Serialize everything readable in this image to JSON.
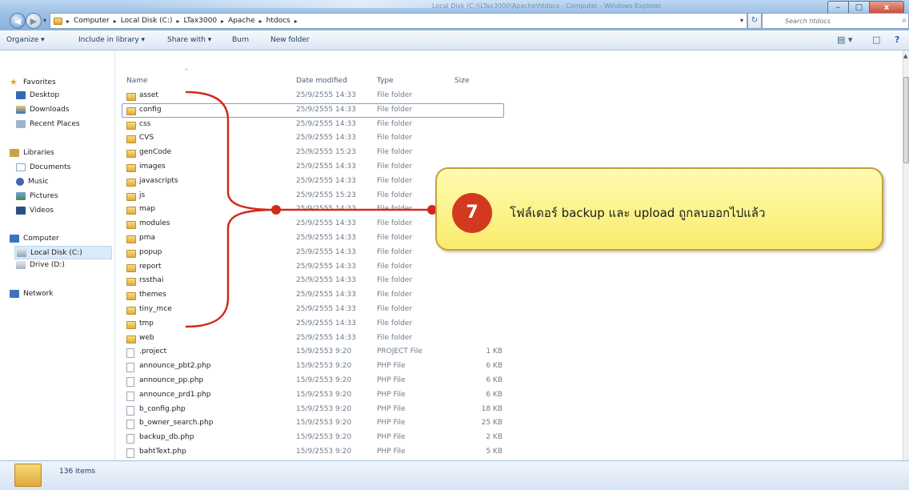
{
  "window": {
    "title": "Local Disk (C:)\\LTax3000\\Apache\\htdocs - Computer - Windows Explorer",
    "minimize": "–",
    "maximize": "□",
    "close": "x"
  },
  "nav": {
    "back": "◀",
    "forward": "▶",
    "dropdown": "▾",
    "refresh": "↻"
  },
  "address": {
    "breadcrumb": [
      "Computer",
      "Local Disk (C:)",
      "LTax3000",
      "Apache",
      "htdocs"
    ],
    "separator": "▸",
    "dropdown": "▾ "
  },
  "search": {
    "placeholder": "Search htdocs",
    "icon": "⌕"
  },
  "toolbar": {
    "organize": "Organize ▾",
    "include": "Include in library ▾",
    "share": "Share with ▾",
    "burn": "Burn",
    "new_folder": "New folder",
    "views": "▤ ▾",
    "preview": "□",
    "help": "?"
  },
  "sidebar": {
    "favorites": "Favorites",
    "favorites_items": [
      "Desktop",
      "Downloads",
      "Recent Places"
    ],
    "libraries": "Libraries",
    "libraries_items": [
      "Documents",
      "Music",
      "Pictures",
      "Videos"
    ],
    "computer": "Computer",
    "computer_items": [
      "Local Disk (C:)",
      "Drive (D:)"
    ],
    "network": "Network"
  },
  "columns": {
    "name": "Name",
    "date": "Date modified",
    "type": "Type",
    "size": "Size",
    "sort": "^"
  },
  "files": [
    {
      "name": "asset",
      "date": "25/9/2555 14:33",
      "type": "File folder",
      "size": "",
      "kind": "folder"
    },
    {
      "name": "config",
      "date": "25/9/2555 14:33",
      "type": "File folder",
      "size": "",
      "kind": "folder"
    },
    {
      "name": "css",
      "date": "25/9/2555 14:33",
      "type": "File folder",
      "size": "",
      "kind": "folder"
    },
    {
      "name": "CVS",
      "date": "25/9/2555 14:33",
      "type": "File folder",
      "size": "",
      "kind": "folder"
    },
    {
      "name": "genCode",
      "date": "25/9/2555 15:23",
      "type": "File folder",
      "size": "",
      "kind": "folder"
    },
    {
      "name": "images",
      "date": "25/9/2555 14:33",
      "type": "File folder",
      "size": "",
      "kind": "folder"
    },
    {
      "name": "javascripts",
      "date": "25/9/2555 14:33",
      "type": "File folder",
      "size": "",
      "kind": "folder"
    },
    {
      "name": "js",
      "date": "25/9/2555 15:23",
      "type": "File folder",
      "size": "",
      "kind": "folder"
    },
    {
      "name": "map",
      "date": "25/9/2555 14:33",
      "type": "File folder",
      "size": "",
      "kind": "folder"
    },
    {
      "name": "modules",
      "date": "25/9/2555 14:33",
      "type": "File folder",
      "size": "",
      "kind": "folder"
    },
    {
      "name": "pma",
      "date": "25/9/2555 14:33",
      "type": "File folder",
      "size": "",
      "kind": "folder"
    },
    {
      "name": "popup",
      "date": "25/9/2555 14:33",
      "type": "File folder",
      "size": "",
      "kind": "folder"
    },
    {
      "name": "report",
      "date": "25/9/2555 14:33",
      "type": "File folder",
      "size": "",
      "kind": "folder"
    },
    {
      "name": "rssthai",
      "date": "25/9/2555 14:33",
      "type": "File folder",
      "size": "",
      "kind": "folder"
    },
    {
      "name": "themes",
      "date": "25/9/2555 14:33",
      "type": "File folder",
      "size": "",
      "kind": "folder"
    },
    {
      "name": "tiny_mce",
      "date": "25/9/2555 14:33",
      "type": "File folder",
      "size": "",
      "kind": "folder"
    },
    {
      "name": "tmp",
      "date": "25/9/2555 14:33",
      "type": "File folder",
      "size": "",
      "kind": "folder"
    },
    {
      "name": "web",
      "date": "25/9/2555 14:33",
      "type": "File folder",
      "size": "",
      "kind": "folder"
    },
    {
      "name": ".project",
      "date": "15/9/2553 9:20",
      "type": "PROJECT File",
      "size": "1 KB",
      "kind": "file"
    },
    {
      "name": "announce_pbt2.php",
      "date": "15/9/2553 9:20",
      "type": "PHP File",
      "size": "6 KB",
      "kind": "file"
    },
    {
      "name": "announce_pp.php",
      "date": "15/9/2553 9:20",
      "type": "PHP File",
      "size": "6 KB",
      "kind": "file"
    },
    {
      "name": "announce_prd1.php",
      "date": "15/9/2553 9:20",
      "type": "PHP File",
      "size": "6 KB",
      "kind": "file"
    },
    {
      "name": "b_config.php",
      "date": "15/9/2553 9:20",
      "type": "PHP File",
      "size": "18 KB",
      "kind": "file"
    },
    {
      "name": "b_owner_search.php",
      "date": "15/9/2553 9:20",
      "type": "PHP File",
      "size": "25 KB",
      "kind": "file"
    },
    {
      "name": "backup_db.php",
      "date": "15/9/2553 9:20",
      "type": "PHP File",
      "size": "2 KB",
      "kind": "file"
    },
    {
      "name": "bahtText.php",
      "date": "15/9/2553 9:20",
      "type": "PHP File",
      "size": "5 KB",
      "kind": "file"
    }
  ],
  "status": {
    "count": "136 items"
  },
  "callout": {
    "number": "7",
    "text": "โฟล์เดอร์ backup และ upload ถูกลบออกไปแล้ว",
    "badge_color": "#d23a1f",
    "bracket_color": "#d22a1a"
  },
  "scroll": {
    "up": "▲"
  }
}
